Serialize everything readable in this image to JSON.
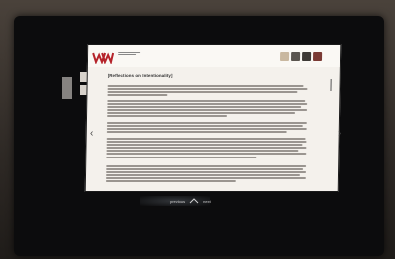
{
  "screen": {
    "logo_text": "MW",
    "document_title": "[Reflections on Intentionality]",
    "bottom_bar": {
      "left_label": "previous",
      "right_label": "next"
    }
  },
  "colors": {
    "logo_red": "#b5232a",
    "screen_bg": "#f4f1ec",
    "frame": "#0c0c0d"
  },
  "thumbnails": [
    "#c9b8a0",
    "#5a554f",
    "#3e3a36",
    "#7a3a34"
  ]
}
